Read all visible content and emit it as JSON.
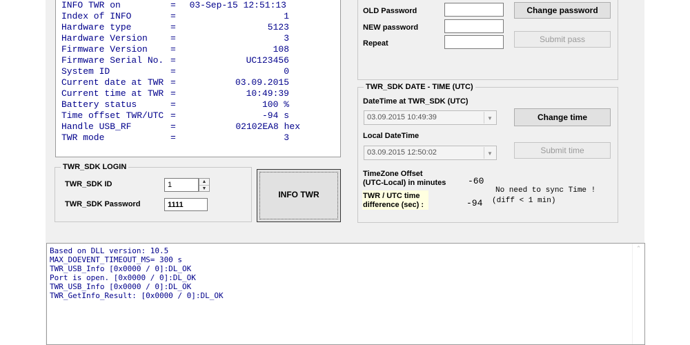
{
  "info": {
    "rows": [
      {
        "key": "INFO TWR on",
        "eq": "=",
        "value": "03-Sep-15 12:51:13"
      },
      {
        "key": "Index of INFO",
        "eq": "=",
        "value": "1"
      },
      {
        "key": "Hardware type",
        "eq": "=",
        "value": "5123"
      },
      {
        "key": "Hardware Version",
        "eq": "=",
        "value": "3"
      },
      {
        "key": "Firmware Version",
        "eq": "=",
        "value": "108"
      },
      {
        "key": "Firmware Serial No.",
        "eq": "=",
        "value": "UC123456"
      },
      {
        "key": "System ID",
        "eq": "=",
        "value": "0"
      },
      {
        "key": "Current date at TWR",
        "eq": "=",
        "value": "03.09.2015"
      },
      {
        "key": "Current time at TWR",
        "eq": "=",
        "value": "10:49:39"
      },
      {
        "key": "Battery status",
        "eq": "=",
        "value": "100 %"
      },
      {
        "key": "Time offset TWR/UTC",
        "eq": "=",
        "value": "-94 s"
      },
      {
        "key": "Handle USB_RF",
        "eq": "=",
        "value": "02102EA8 hex"
      },
      {
        "key": "TWR mode",
        "eq": "=",
        "value": "3"
      }
    ]
  },
  "login": {
    "title": "TWR_SDK LOGIN",
    "id_label": "TWR_SDK ID",
    "id_value": "1",
    "password_label": "TWR_SDK Password",
    "password_value": "1111",
    "info_button": "INFO TWR"
  },
  "password": {
    "old_label": "OLD Password",
    "new_label": "NEW password",
    "repeat_label": "Repeat",
    "old_value": "",
    "new_value": "",
    "repeat_value": "",
    "change_button": "Change password",
    "submit_button": "Submit pass"
  },
  "datetime": {
    "title": "TWR_SDK DATE - TIME (UTC)",
    "twr_label": "DateTime at TWR_SDK (UTC)",
    "twr_value": "03.09.2015 10:49:39",
    "change_button": "Change time",
    "local_label": "Local DateTime",
    "local_value": "03.09.2015 12:50:02",
    "submit_button": "Submit time",
    "tz_label_1": "TimeZone Offset",
    "tz_label_2": "(UTC-Local) in minutes",
    "tz_value": "-60",
    "diff_label_1": "TWR / UTC time",
    "diff_label_2": "difference (sec) :",
    "diff_value": "-94",
    "sync_msg_1": "No need to sync Time !",
    "sync_msg_2": "(diff < 1 min)"
  },
  "log": {
    "lines": [
      "Based on DLL version: 10.5",
      "MAX_DOEVENT_TIMEOUT_MS= 300 s",
      "TWR_USB_Info [0x0000 / 0]:DL_OK",
      "Port is open. [0x0000 / 0]:DL_OK",
      "TWR_USB_Info [0x0000 / 0]:DL_OK",
      "TWR_GetInfo_Result: [0x0000 / 0]:DL_OK"
    ]
  },
  "colors": {
    "text_blue": "#00008b",
    "highlight": "#ffffe0"
  }
}
